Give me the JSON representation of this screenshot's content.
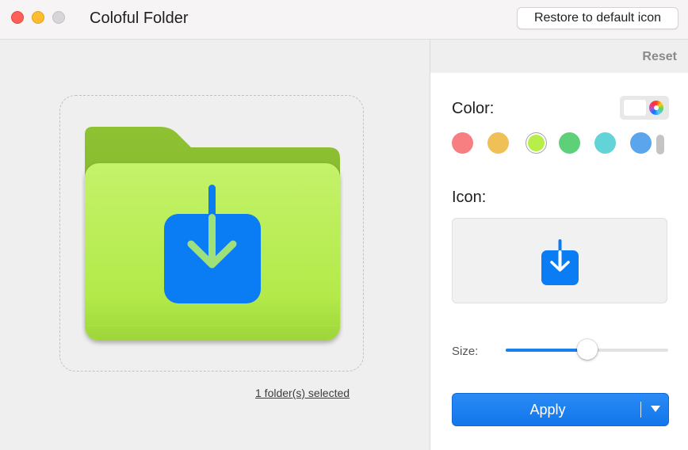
{
  "window": {
    "title": "Coloful Folder",
    "restore_button": "Restore to default icon"
  },
  "left": {
    "selection_text": "1 folder(s) selected"
  },
  "right": {
    "reset_label": "Reset",
    "color_label": "Color:",
    "icon_label": "Icon:",
    "size_label": "Size:",
    "apply_label": "Apply",
    "size_level_percent": 50
  },
  "swatches": [
    {
      "name": "red",
      "color": "#f77f82",
      "selected": false
    },
    {
      "name": "yellow",
      "color": "#eec055",
      "selected": false
    },
    {
      "name": "lime",
      "color": "#b7ee4a",
      "selected": true
    },
    {
      "name": "green",
      "color": "#5fd07a",
      "selected": false
    },
    {
      "name": "teal",
      "color": "#62d3d7",
      "selected": false
    },
    {
      "name": "blue",
      "color": "#5ba5ec",
      "selected": false
    }
  ],
  "colors": {
    "folder_front": "#b7ee4a",
    "folder_back": "#84b92b",
    "icon_blue": "#0a7cf4",
    "accent": "#1a7ef0"
  },
  "icons": {
    "folder": "folder-icon",
    "download": "download-arrow-icon",
    "color_wheel": "color-wheel-icon",
    "dropdown": "chevron-down-icon"
  }
}
